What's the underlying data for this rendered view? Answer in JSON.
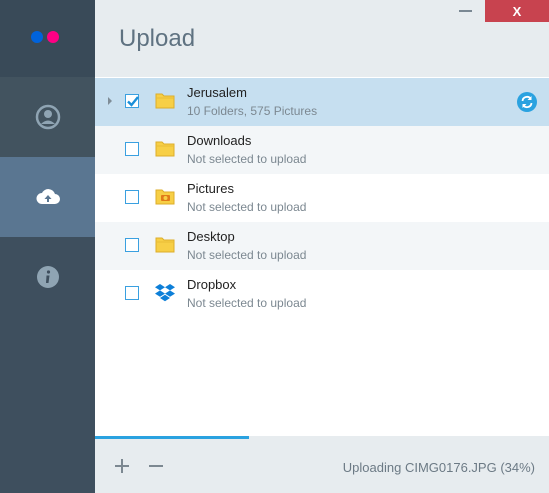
{
  "window": {
    "close_label": "X"
  },
  "header": {
    "title": "Upload"
  },
  "sidebar": {
    "items": [
      {
        "name": "profile",
        "icon": "user-icon"
      },
      {
        "name": "upload",
        "icon": "cloud-upload-icon",
        "active": true
      },
      {
        "name": "info",
        "icon": "info-icon"
      }
    ]
  },
  "folders": [
    {
      "name": "Jerusalem",
      "status": "10 Folders, 575 Pictures",
      "checked": true,
      "icon": "folder-icon"
    },
    {
      "name": "Downloads",
      "status": "Not selected to upload",
      "checked": false,
      "icon": "folder-icon"
    },
    {
      "name": "Pictures",
      "status": "Not selected to upload",
      "checked": false,
      "icon": "pictures-folder-icon"
    },
    {
      "name": "Desktop",
      "status": "Not selected to upload",
      "checked": false,
      "icon": "folder-icon"
    },
    {
      "name": "Dropbox",
      "status": "Not selected to upload",
      "checked": false,
      "icon": "dropbox-icon"
    }
  ],
  "footer": {
    "add_label": "+",
    "remove_label": "−",
    "status": "Uploading CIMG0176.JPG (34%)",
    "progress": 0.34
  },
  "colors": {
    "accent": "#2aa2e0",
    "flickr_blue": "#0063dc",
    "flickr_pink": "#ff0084",
    "close": "#c8434f"
  }
}
